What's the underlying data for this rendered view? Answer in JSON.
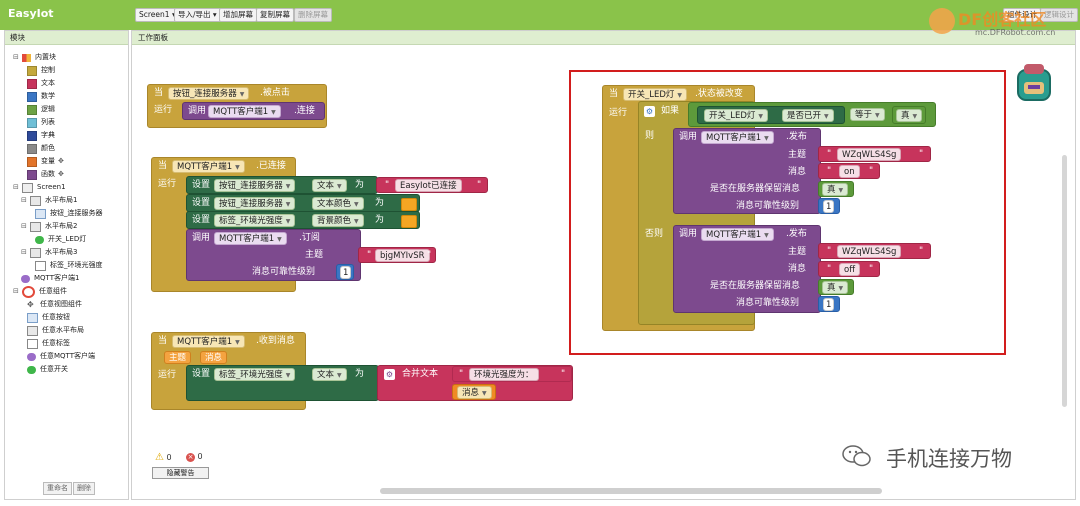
{
  "app": {
    "title": "EasyIot"
  },
  "toolbar": {
    "screen_select": "Screen1 ▾",
    "import_export": "导入/导出 ▾",
    "add_screen": "增加屏幕",
    "copy_screen": "复制屏幕",
    "delete_screen": "删除屏幕",
    "right_btn1": "组件设计",
    "right_btn2": "逻辑设计"
  },
  "watermark": {
    "brand": "DF创客社区",
    "url": "mc.DFRobot.com.cn",
    "caption": "手机连接万物"
  },
  "left_panel": {
    "header": "模块",
    "builtin": {
      "label": "内置块",
      "items": [
        {
          "label": "控制",
          "color": "#c4a93d"
        },
        {
          "label": "文本",
          "color": "#c7345c"
        },
        {
          "label": "数学",
          "color": "#3a76c4"
        },
        {
          "label": "逻辑",
          "color": "#6da245"
        },
        {
          "label": "列表",
          "color": "#6fbfd6"
        },
        {
          "label": "字典",
          "color": "#2e4a9a"
        },
        {
          "label": "颜色",
          "color": "#8a8a8a"
        },
        {
          "label": "变量",
          "color": "#e2742a"
        },
        {
          "label": "函数",
          "color": "#7d4a8e"
        }
      ]
    },
    "screen1": "Screen1",
    "components": [
      {
        "label": "水平布局1",
        "level": 2
      },
      {
        "label": "按钮_连接服务器",
        "level": 3
      },
      {
        "label": "水平布局2",
        "level": 2
      },
      {
        "label": "开关_LED灯",
        "level": 3
      },
      {
        "label": "水平布局3",
        "level": 2
      },
      {
        "label": "标签_环境光强度",
        "level": 3
      },
      {
        "label": "MQTT客户端1",
        "level": 2
      }
    ],
    "any_component": {
      "label": "任意组件",
      "items": [
        "任意视图组件",
        "任意按钮",
        "任意水平布局",
        "任意标签",
        "任意MQTT客户端",
        "任意开关"
      ]
    },
    "rename_button": "重命名",
    "delete_button": "删除"
  },
  "workspace": {
    "header": "工作面板",
    "warnings_count": "0",
    "errors_count": "0",
    "hide_warnings": "隐藏警告"
  },
  "blocks": {
    "when": "当",
    "do": "运行",
    "set": "设置",
    "call": "调用",
    "to": "为",
    "b1": {
      "component": "按钮_连接服务器",
      "event": ".被点击",
      "call_component": "MQTT客户端1",
      "method": ".连接"
    },
    "b2": {
      "component": "MQTT客户端1",
      "event": ".已连接",
      "s1_comp": "按钮_连接服务器",
      "s1_prop": "文本",
      "s1_value": "EasyIot已连接",
      "s2_comp": "按钮_连接服务器",
      "s2_prop": "文本颜色",
      "s3_comp": "标签_环境光强度",
      "s3_prop": "背景颜色",
      "call_component": "MQTT客户端1",
      "method": ".订阅",
      "topic_label": "主题",
      "topic_value": "bjgMYIvSR",
      "qos_label": "消息可靠性级别",
      "qos_value": "1"
    },
    "b3": {
      "component": "MQTT客户端1",
      "event": ".收到消息",
      "param1": "主题",
      "param2": "消息",
      "set_comp": "标签_环境光强度",
      "set_prop": "文本",
      "join_label": "合并文本",
      "text_value": "环境光强度为：",
      "msg_var": "消息"
    },
    "b4": {
      "component": "开关_LED灯",
      "event": ".状态被改变",
      "if_label": "如果",
      "then_label": "则",
      "else_label": "否则",
      "cond_comp": "开关_LED灯",
      "cond_prop": "是否已开",
      "cond_op": "等于",
      "cond_val": "真",
      "pub_component": "MQTT客户端1",
      "pub_method": ".发布",
      "topic_label": "主题",
      "message_label": "消息",
      "retain_label": "是否在服务器保留消息",
      "qos_label": "消息可靠性级别",
      "then_topic": "WZqWLS4Sg",
      "then_msg": "on",
      "then_retain": "真",
      "then_qos": "1",
      "else_topic": "WZqWLS4Sg",
      "else_msg": "off",
      "else_retain": "真",
      "else_qos": "1"
    }
  }
}
